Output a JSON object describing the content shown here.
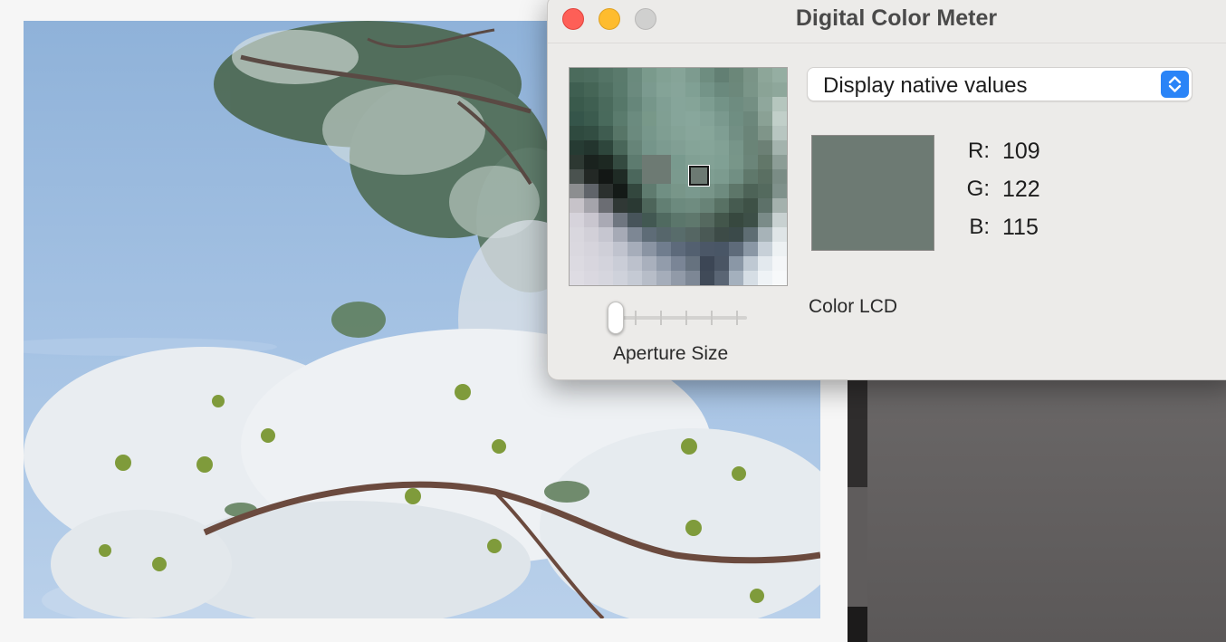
{
  "window": {
    "title": "Digital Color Meter"
  },
  "controls": {
    "display_mode": "Display native values",
    "aperture_label": "Aperture Size",
    "aperture_level": 0
  },
  "color": {
    "swatch_hex": "#6d7a73",
    "channels": [
      {
        "label": "R:",
        "value": "109"
      },
      {
        "label": "G:",
        "value": "122"
      },
      {
        "label": "B:",
        "value": "115"
      }
    ],
    "display_name": "Color LCD"
  },
  "magnifier_pixels": [
    [
      "#4b6b5c",
      "#4d6d5f",
      "#547466",
      "#5a7a6c",
      "#6a8a7d",
      "#7a9a8c",
      "#82a194",
      "#86a498",
      "#7d9b8f",
      "#6e8d80",
      "#627f73",
      "#6b8779",
      "#7a9487",
      "#8da699",
      "#95aea2"
    ],
    [
      "#3f5f51",
      "#456556",
      "#4f6f61",
      "#597a6c",
      "#6b8a7e",
      "#7b9a8f",
      "#84a397",
      "#87a59a",
      "#80a094",
      "#749488",
      "#6a897d",
      "#6c887b",
      "#7a9588",
      "#8aa396",
      "#8ea79b"
    ],
    [
      "#3a5a4c",
      "#3f5f51",
      "#4a6a5c",
      "#567769",
      "#66867a",
      "#76968a",
      "#809f94",
      "#86a59a",
      "#85a498",
      "#7d9d91",
      "#739387",
      "#6e8c80",
      "#748f83",
      "#8fa79c",
      "#b5c6be"
    ],
    [
      "#35554a",
      "#3b5b4e",
      "#496a5c",
      "#5a7b6d",
      "#6b8b7f",
      "#789889",
      "#809f93",
      "#86a59a",
      "#88a79c",
      "#84a398",
      "#7a998e",
      "#6f8e82",
      "#6c877b",
      "#8aa195",
      "#c1cfc9"
    ],
    [
      "#2f4a3f",
      "#324d42",
      "#3f5c50",
      "#577567",
      "#6b8a7e",
      "#77978b",
      "#7f9e92",
      "#84a397",
      "#88a69b",
      "#87a69a",
      "#7f9e93",
      "#728f84",
      "#6a8478",
      "#7f9589",
      "#b8c6c1"
    ],
    [
      "#263b33",
      "#23352e",
      "#2e463c",
      "#496659",
      "#668478",
      "#75958a",
      "#7c9b90",
      "#819f94",
      "#85a498",
      "#86a599",
      "#82a195",
      "#779589",
      "#6a8477",
      "#6c8075",
      "#a3b3ad"
    ],
    [
      "#2d3832",
      "#1a221e",
      "#1d2822",
      "#344a40",
      "#5d7b6f",
      "#6d7a73",
      "#6d7a73",
      "#799a8e",
      "#81a094",
      "#83a296",
      "#80a094",
      "#789689",
      "#6b8579",
      "#627769",
      "#8c9d96"
    ],
    [
      "#4a524f",
      "#232825",
      "#131715",
      "#1f2b25",
      "#4b675c",
      "#6d7a73",
      "#6d7a73",
      "#7b9a8e",
      "#7e9d92",
      "#7f9e92",
      "#7c9b8f",
      "#718f83",
      "#5f786b",
      "#5a6f62",
      "#7a8c85"
    ],
    [
      "#8c8e90",
      "#60646a",
      "#2b302e",
      "#141a17",
      "#33473e",
      "#5f7b6f",
      "#708f83",
      "#789689",
      "#7a998e",
      "#789589",
      "#6e8b7f",
      "#5d7669",
      "#4d6357",
      "#546a5e",
      "#7f918b"
    ],
    [
      "#c7c3c9",
      "#a5a4ab",
      "#6b6d73",
      "#303835",
      "#2a3933",
      "#4d655a",
      "#627f73",
      "#6c8a7e",
      "#6f8c80",
      "#688377",
      "#587164",
      "#465b50",
      "#3e5146",
      "#5d7169",
      "#a4b1ad"
    ],
    [
      "#d6d3db",
      "#c9c6cf",
      "#a9a9b4",
      "#6f7680",
      "#47545a",
      "#425852",
      "#506a60",
      "#5b766b",
      "#5f786d",
      "#55695f",
      "#43564b",
      "#37483f",
      "#3d4f47",
      "#7a8b88",
      "#c8d1d1"
    ],
    [
      "#d9d7de",
      "#d2d0d8",
      "#c6c6d0",
      "#a6aab6",
      "#7d8794",
      "#5e6c77",
      "#56666b",
      "#586c6b",
      "#556663",
      "#4a5955",
      "#3d4b47",
      "#3b4a4a",
      "#5e6d73",
      "#a7b3b8",
      "#dfe5e7"
    ],
    [
      "#dad8df",
      "#d6d4dc",
      "#cfcfd8",
      "#c0c3ce",
      "#a6adba",
      "#8a94a3",
      "#707d8e",
      "#5d6a7b",
      "#536070",
      "#4b5767",
      "#495666",
      "#5e6b7a",
      "#8a97a5",
      "#c7d0d8",
      "#edf1f3"
    ],
    [
      "#dcdae1",
      "#d8d6de",
      "#d3d3dc",
      "#cacdd7",
      "#bcc1cc",
      "#a9b0bd",
      "#929cab",
      "#7a8596",
      "#66727f",
      "#3c4655",
      "#4a5564",
      "#8a97a6",
      "#bfc9d3",
      "#e3e9ee",
      "#f4f6f8"
    ],
    [
      "#dedce3",
      "#dad8e0",
      "#d6d6de",
      "#cfd2db",
      "#c5cad4",
      "#b7bdc8",
      "#a5adba",
      "#919aa8",
      "#7d8795",
      "#404a58",
      "#5a6574",
      "#a4b0bd",
      "#d6dee5",
      "#eff3f6",
      "#f7f9fa"
    ]
  ]
}
